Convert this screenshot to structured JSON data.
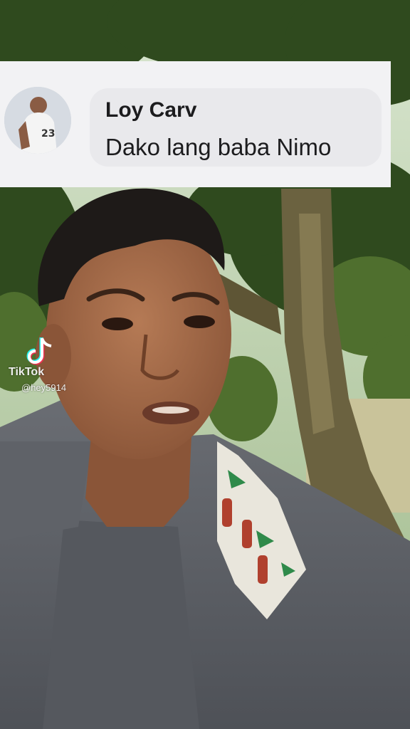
{
  "comment": {
    "author": "Loy Carv",
    "text": "Dako lang baba Nimo",
    "avatar_icon": "user-avatar"
  },
  "watermark": {
    "brand": "TikTok",
    "username": "@hey5914",
    "logo_icon": "tiktok-logo-icon"
  },
  "colors": {
    "card_bg": "#f2f2f4",
    "bubble_bg": "#e9e9ec",
    "text": "#1c1c1e"
  }
}
